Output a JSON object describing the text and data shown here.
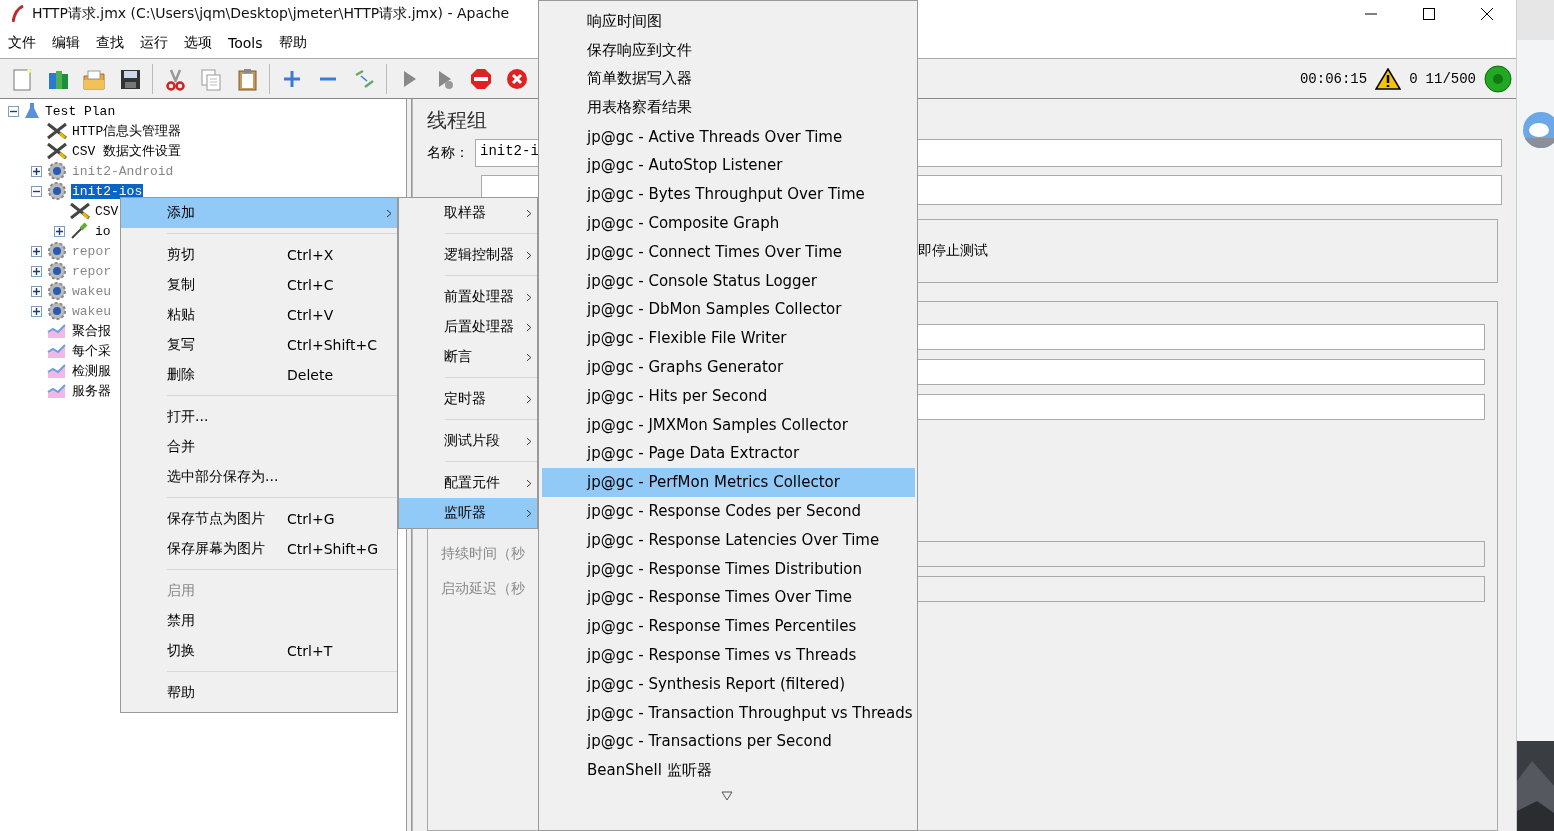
{
  "window": {
    "title": "HTTP请求.jmx (C:\\Users\\jqm\\Desktop\\jmeter\\HTTP请求.jmx) - Apache"
  },
  "menu_bar": [
    "文件",
    "编辑",
    "查找",
    "运行",
    "选项",
    "Tools",
    "帮助"
  ],
  "status": {
    "elapsed": "00:06:15",
    "errors": "0",
    "threads": "11/500"
  },
  "tree": [
    {
      "label": "Test Plan",
      "kind": "plan",
      "expanded": true,
      "selected": false,
      "disabled": false,
      "children": [
        {
          "label": "HTTP信息头管理器",
          "kind": "config",
          "selected": false,
          "disabled": false
        },
        {
          "label": "CSV 数据文件设置",
          "kind": "config",
          "selected": false,
          "disabled": false
        },
        {
          "label": "init2-Android",
          "kind": "thread",
          "expanded": false,
          "selected": false,
          "disabled": true
        },
        {
          "label": "init2-ios",
          "kind": "thread",
          "expanded": true,
          "selected": true,
          "disabled": false,
          "children": [
            {
              "label": "CSV",
              "kind": "config",
              "selected": false,
              "disabled": false
            },
            {
              "label": "io",
              "kind": "sampler",
              "expanded": false,
              "selected": false,
              "disabled": false
            }
          ]
        },
        {
          "label": "repor",
          "kind": "thread",
          "expanded": false,
          "selected": false,
          "disabled": true
        },
        {
          "label": "repor",
          "kind": "thread",
          "expanded": false,
          "selected": false,
          "disabled": true
        },
        {
          "label": "wakeu",
          "kind": "thread",
          "expanded": false,
          "selected": false,
          "disabled": true
        },
        {
          "label": "wakeu",
          "kind": "thread",
          "expanded": false,
          "selected": false,
          "disabled": true
        },
        {
          "label": "聚合报",
          "kind": "listener",
          "selected": false,
          "disabled": false
        },
        {
          "label": "每个采",
          "kind": "listener",
          "selected": false,
          "disabled": false
        },
        {
          "label": "检测服",
          "kind": "listener",
          "selected": false,
          "disabled": false
        },
        {
          "label": "服务器",
          "kind": "listener",
          "selected": false,
          "disabled": false
        }
      ]
    }
  ],
  "panel": {
    "title": "线程组",
    "name_label": "名称：",
    "name_value": "init2-i",
    "option_text": "即停止测试",
    "duration_label": "持续时间（秒",
    "delay_label": "启动延迟（秒"
  },
  "context_menu": [
    {
      "kind": "item",
      "label": "添加",
      "submenu": true,
      "selected": true,
      "disabled": false
    },
    {
      "kind": "separator"
    },
    {
      "kind": "item",
      "label": "剪切",
      "shortcut": "Ctrl+X",
      "submenu": false,
      "selected": false,
      "disabled": false
    },
    {
      "kind": "item",
      "label": "复制",
      "shortcut": "Ctrl+C",
      "submenu": false,
      "selected": false,
      "disabled": false
    },
    {
      "kind": "item",
      "label": "粘贴",
      "shortcut": "Ctrl+V",
      "submenu": false,
      "selected": false,
      "disabled": false
    },
    {
      "kind": "item",
      "label": "复写",
      "shortcut": "Ctrl+Shift+C",
      "submenu": false,
      "selected": false,
      "disabled": false
    },
    {
      "kind": "item",
      "label": "删除",
      "shortcut": "Delete",
      "submenu": false,
      "selected": false,
      "disabled": false
    },
    {
      "kind": "separator"
    },
    {
      "kind": "item",
      "label": "打开...",
      "submenu": false,
      "selected": false,
      "disabled": false
    },
    {
      "kind": "item",
      "label": "合并",
      "submenu": false,
      "selected": false,
      "disabled": false
    },
    {
      "kind": "item",
      "label": "选中部分保存为...",
      "submenu": false,
      "selected": false,
      "disabled": false
    },
    {
      "kind": "separator"
    },
    {
      "kind": "item",
      "label": "保存节点为图片",
      "shortcut": "Ctrl+G",
      "submenu": false,
      "selected": false,
      "disabled": false
    },
    {
      "kind": "item",
      "label": "保存屏幕为图片",
      "shortcut": "Ctrl+Shift+G",
      "submenu": false,
      "selected": false,
      "disabled": false
    },
    {
      "kind": "separator"
    },
    {
      "kind": "item",
      "label": "启用",
      "submenu": false,
      "selected": false,
      "disabled": true
    },
    {
      "kind": "item",
      "label": "禁用",
      "submenu": false,
      "selected": false,
      "disabled": false
    },
    {
      "kind": "item",
      "label": "切换",
      "shortcut": "Ctrl+T",
      "submenu": false,
      "selected": false,
      "disabled": false
    },
    {
      "kind": "separator"
    },
    {
      "kind": "item",
      "label": "帮助",
      "submenu": false,
      "selected": false,
      "disabled": false
    }
  ],
  "add_submenu": [
    {
      "kind": "item",
      "label": "取样器",
      "submenu": true,
      "selected": false,
      "disabled": false
    },
    {
      "kind": "separator"
    },
    {
      "kind": "item",
      "label": "逻辑控制器",
      "submenu": true,
      "selected": false,
      "disabled": false
    },
    {
      "kind": "separator"
    },
    {
      "kind": "item",
      "label": "前置处理器",
      "submenu": true,
      "selected": false,
      "disabled": false
    },
    {
      "kind": "item",
      "label": "后置处理器",
      "submenu": true,
      "selected": false,
      "disabled": false
    },
    {
      "kind": "item",
      "label": "断言",
      "submenu": true,
      "selected": false,
      "disabled": false
    },
    {
      "kind": "separator"
    },
    {
      "kind": "item",
      "label": "定时器",
      "submenu": true,
      "selected": false,
      "disabled": false
    },
    {
      "kind": "separator"
    },
    {
      "kind": "item",
      "label": "测试片段",
      "submenu": true,
      "selected": false,
      "disabled": false
    },
    {
      "kind": "separator"
    },
    {
      "kind": "item",
      "label": "配置元件",
      "submenu": true,
      "selected": false,
      "disabled": false
    },
    {
      "kind": "item",
      "label": "监听器",
      "submenu": true,
      "selected": true,
      "disabled": false
    }
  ],
  "listener_menu": [
    {
      "label": "响应时间图",
      "selected": false
    },
    {
      "label": "保存响应到文件",
      "selected": false
    },
    {
      "label": "简单数据写入器",
      "selected": false
    },
    {
      "label": "用表格察看结果",
      "selected": false
    },
    {
      "label": "jp@gc - Active Threads Over Time",
      "selected": false
    },
    {
      "label": "jp@gc - AutoStop Listener",
      "selected": false
    },
    {
      "label": "jp@gc - Bytes Throughput Over Time",
      "selected": false
    },
    {
      "label": "jp@gc - Composite Graph",
      "selected": false
    },
    {
      "label": "jp@gc - Connect Times Over Time",
      "selected": false
    },
    {
      "label": "jp@gc - Console Status Logger",
      "selected": false
    },
    {
      "label": "jp@gc - DbMon Samples Collector",
      "selected": false
    },
    {
      "label": "jp@gc - Flexible File Writer",
      "selected": false
    },
    {
      "label": "jp@gc - Graphs Generator",
      "selected": false
    },
    {
      "label": "jp@gc - Hits per Second",
      "selected": false
    },
    {
      "label": "jp@gc - JMXMon Samples Collector",
      "selected": false
    },
    {
      "label": "jp@gc - Page Data Extractor",
      "selected": false
    },
    {
      "label": "jp@gc - PerfMon Metrics Collector",
      "selected": true
    },
    {
      "label": "jp@gc - Response Codes per Second",
      "selected": false
    },
    {
      "label": "jp@gc - Response Latencies Over Time",
      "selected": false
    },
    {
      "label": "jp@gc - Response Times Distribution",
      "selected": false
    },
    {
      "label": "jp@gc - Response Times Over Time",
      "selected": false
    },
    {
      "label": "jp@gc - Response Times Percentiles",
      "selected": false
    },
    {
      "label": "jp@gc - Response Times vs Threads",
      "selected": false
    },
    {
      "label": "jp@gc - Synthesis Report (filtered)",
      "selected": false
    },
    {
      "label": "jp@gc - Transaction Throughput vs Threads",
      "selected": false
    },
    {
      "label": "jp@gc - Transactions per Second",
      "selected": false
    },
    {
      "label": "BeanShell 监听器",
      "selected": false
    }
  ]
}
